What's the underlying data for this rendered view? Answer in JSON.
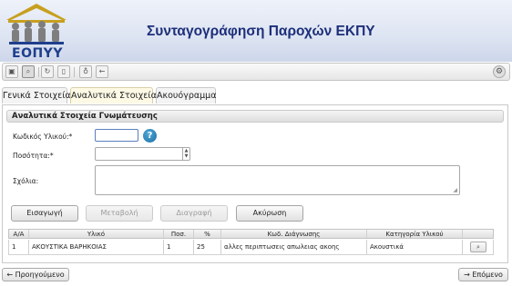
{
  "header": {
    "logo_text": "ΕΟΠΥΥ",
    "app_title": "Συνταγογράφηση Παροχών ΕΚΠΥ"
  },
  "toolbar": {
    "buttons": [
      {
        "icon": "save-icon",
        "glyph": "▣"
      },
      {
        "icon": "search-icon",
        "glyph": "⌕"
      },
      {
        "icon": "refresh-icon",
        "glyph": "↻"
      },
      {
        "icon": "document-icon",
        "glyph": "▯"
      },
      {
        "icon": "pin-icon",
        "glyph": "♁"
      },
      {
        "icon": "back-icon",
        "glyph": "←"
      }
    ],
    "settings_glyph": "⚙"
  },
  "tabs": [
    {
      "label": "Γενικά Στοιχεία",
      "active": false
    },
    {
      "label": "Αναλυτικά Στοιχεία",
      "active": true
    },
    {
      "label": "Ακουόγραμμα",
      "active": false
    }
  ],
  "panel": {
    "title": "Αναλυτικά Στοιχεία Γνωμάτευσης"
  },
  "form": {
    "code_label": "Κωδικός Υλικού:*",
    "code_value": "",
    "help_glyph": "?",
    "quantity_label": "Ποσότητα:*",
    "quantity_value": "",
    "comments_label": "Σχόλια:",
    "comments_value": ""
  },
  "actions": {
    "insert": "Εισαγωγή",
    "modify": "Μεταβολή",
    "delete": "Διαγραφή",
    "cancel": "Ακύρωση"
  },
  "table": {
    "headers": [
      "Α/Α",
      "Υλικό",
      "Ποσ.",
      "%",
      "Κωδ. Διάγνωσης",
      "Κατηγορία Υλικού"
    ],
    "rows": [
      {
        "aa": "1",
        "material": "ΑΚΟΥΣΤΙΚΑ ΒΑΡΗΚΟΙΑΣ",
        "qty": "1",
        "percent": "25",
        "diagnosis": "αλλες περιπτωσεις απωλειας ακοης",
        "category": "Ακουστικά"
      }
    ]
  },
  "nav": {
    "previous": "← Προηγούμενο",
    "next": "→ Επόμενο"
  }
}
